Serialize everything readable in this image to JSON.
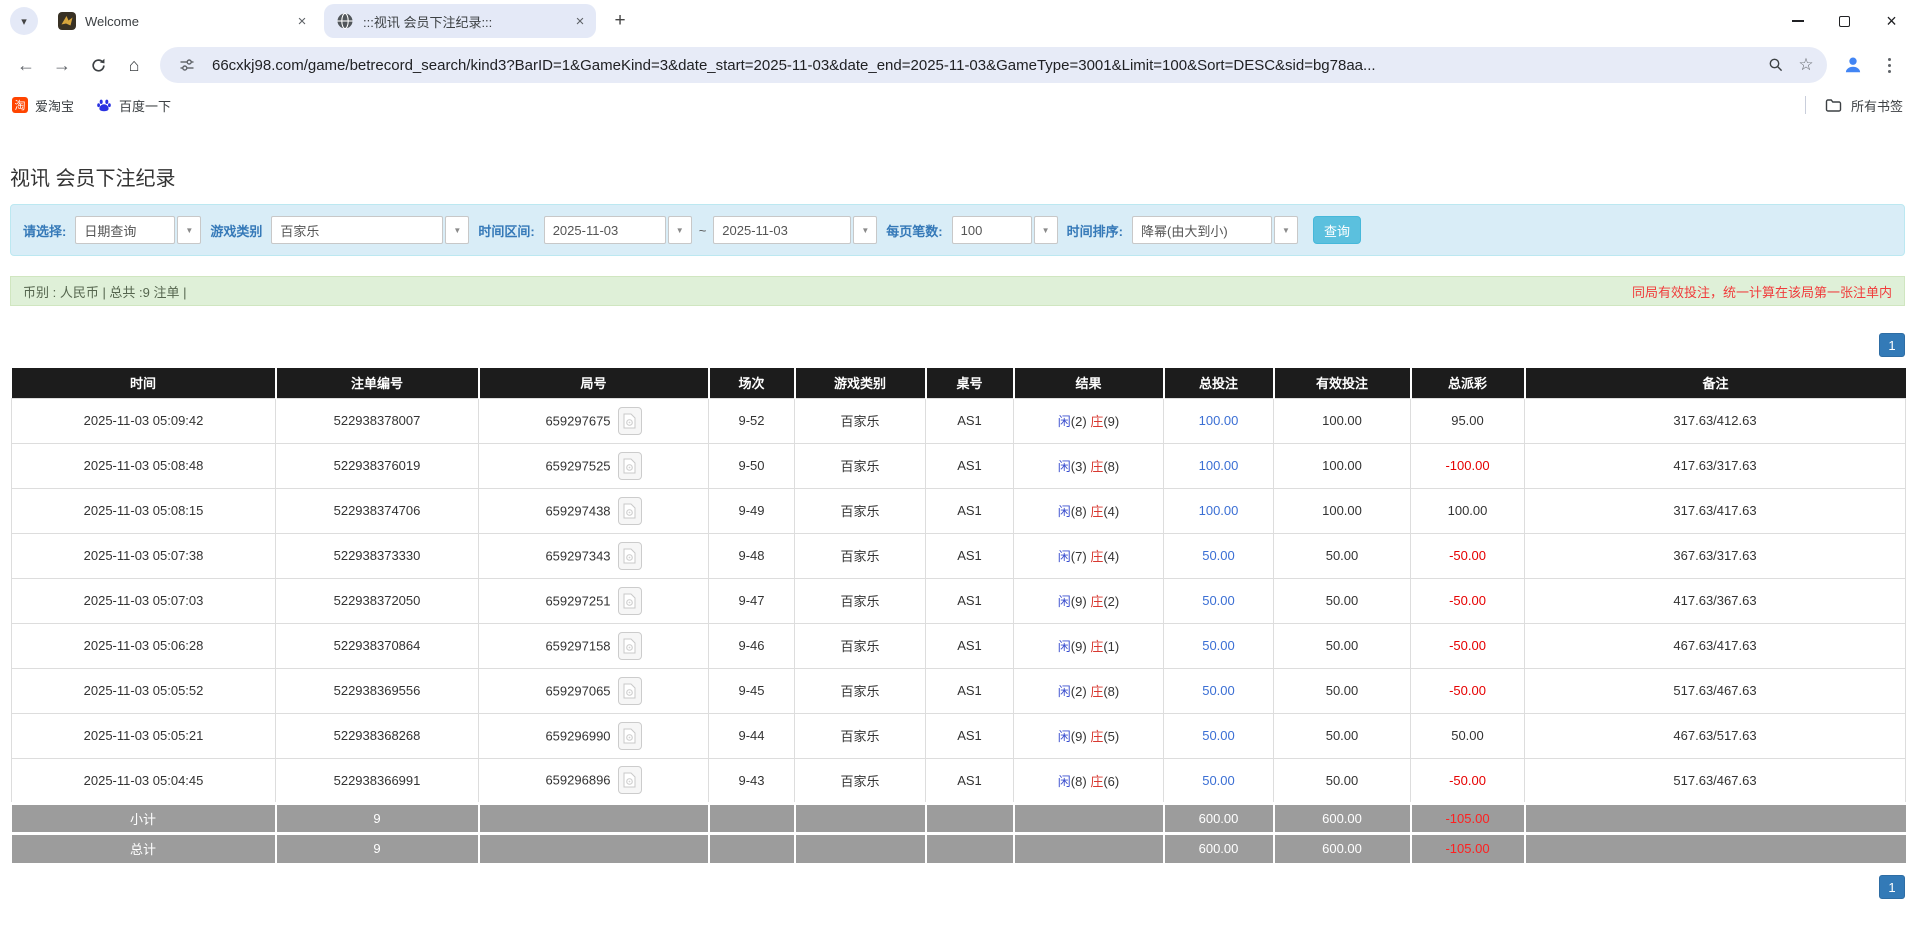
{
  "browser": {
    "tabs": [
      {
        "title": "Welcome"
      },
      {
        "title": ":::视讯 会员下注纪录:::"
      }
    ],
    "url": "66cxkj98.com/game/betrecord_search/kind3?BarID=1&GameKind=3&date_start=2025-11-03&date_end=2025-11-03&GameType=3001&Limit=100&Sort=DESC&sid=bg78aa...",
    "bookmarks": [
      {
        "label": "爱淘宝",
        "icon": "taobao-icon",
        "icon_glyph": "淘"
      },
      {
        "label": "百度一下",
        "icon": "baidu-paw-icon"
      }
    ],
    "all_bookmarks_label": "所有书签",
    "icons": {
      "chevron_down": "▾",
      "close": "×",
      "new_tab": "+",
      "back": "←",
      "forward": "→",
      "home": "⌂",
      "star": "☆"
    }
  },
  "page": {
    "title": "视讯 会员下注纪录",
    "filters": {
      "query_type_label": "请选择:",
      "query_type_value": "日期查询",
      "game_type_label": "游戏类别",
      "game_type_value": "百家乐",
      "date_range_label": "时间区间:",
      "date_start": "2025-11-03",
      "range_separator": "~",
      "date_end": "2025-11-03",
      "page_size_label": "每页笔数:",
      "page_size_value": "100",
      "sort_label": "时间排序:",
      "sort_value": "降幂(由大到小)",
      "search_button_label": "查询",
      "combo_arrow": "▼"
    },
    "summary": {
      "left_text": "币别 : 人民币 | 总共 :9 注单 |",
      "right_note": "同局有效投注，统一计算在该局第一张注单内"
    },
    "pagination": {
      "page": "1"
    },
    "colors": {
      "accent_blue": "#337ab7",
      "search_button_blue": "#5bc0de",
      "table_header_bg": "#1c1c1c",
      "table_footer_bg": "#9c9c9c",
      "negative_red": "#e60000",
      "bet_link_blue": "#3b6fd4",
      "player_blue": "#3c50d0",
      "banker_red": "#d83931",
      "filter_bar_bg": "#d9edf7",
      "summary_bar_bg": "#dff0d8"
    },
    "table": {
      "headers": [
        "时间",
        "注单编号",
        "局号",
        "场次",
        "游戏类别",
        "桌号",
        "结果",
        "总投注",
        "有效投注",
        "总派彩",
        "备注"
      ],
      "rows": [
        {
          "time": "2025-11-03 05:09:42",
          "bet_id": "522938378007",
          "round_id": "659297675",
          "session": "9-52",
          "game_type": "百家乐",
          "table_no": "AS1",
          "result": {
            "p": "闲",
            "pn": "(2)",
            "b": "庄",
            "bn": "(9)"
          },
          "total_bet": "100.00",
          "valid_bet": "100.00",
          "payout": "95.00",
          "note": "317.63/412.63"
        },
        {
          "time": "2025-11-03 05:08:48",
          "bet_id": "522938376019",
          "round_id": "659297525",
          "session": "9-50",
          "game_type": "百家乐",
          "table_no": "AS1",
          "result": {
            "p": "闲",
            "pn": "(3)",
            "b": "庄",
            "bn": "(8)"
          },
          "total_bet": "100.00",
          "valid_bet": "100.00",
          "payout": "-100.00",
          "note": "417.63/317.63"
        },
        {
          "time": "2025-11-03 05:08:15",
          "bet_id": "522938374706",
          "round_id": "659297438",
          "session": "9-49",
          "game_type": "百家乐",
          "table_no": "AS1",
          "result": {
            "p": "闲",
            "pn": "(8)",
            "b": "庄",
            "bn": "(4)"
          },
          "total_bet": "100.00",
          "valid_bet": "100.00",
          "payout": "100.00",
          "note": "317.63/417.63"
        },
        {
          "time": "2025-11-03 05:07:38",
          "bet_id": "522938373330",
          "round_id": "659297343",
          "session": "9-48",
          "game_type": "百家乐",
          "table_no": "AS1",
          "result": {
            "p": "闲",
            "pn": "(7)",
            "b": "庄",
            "bn": "(4)"
          },
          "total_bet": "50.00",
          "valid_bet": "50.00",
          "payout": "-50.00",
          "note": "367.63/317.63"
        },
        {
          "time": "2025-11-03 05:07:03",
          "bet_id": "522938372050",
          "round_id": "659297251",
          "session": "9-47",
          "game_type": "百家乐",
          "table_no": "AS1",
          "result": {
            "p": "闲",
            "pn": "(9)",
            "b": "庄",
            "bn": "(2)"
          },
          "total_bet": "50.00",
          "valid_bet": "50.00",
          "payout": "-50.00",
          "note": "417.63/367.63"
        },
        {
          "time": "2025-11-03 05:06:28",
          "bet_id": "522938370864",
          "round_id": "659297158",
          "session": "9-46",
          "game_type": "百家乐",
          "table_no": "AS1",
          "result": {
            "p": "闲",
            "pn": "(9)",
            "b": "庄",
            "bn": "(1)"
          },
          "total_bet": "50.00",
          "valid_bet": "50.00",
          "payout": "-50.00",
          "note": "467.63/417.63"
        },
        {
          "time": "2025-11-03 05:05:52",
          "bet_id": "522938369556",
          "round_id": "659297065",
          "session": "9-45",
          "game_type": "百家乐",
          "table_no": "AS1",
          "result": {
            "p": "闲",
            "pn": "(2)",
            "b": "庄",
            "bn": "(8)"
          },
          "total_bet": "50.00",
          "valid_bet": "50.00",
          "payout": "-50.00",
          "note": "517.63/467.63"
        },
        {
          "time": "2025-11-03 05:05:21",
          "bet_id": "522938368268",
          "round_id": "659296990",
          "session": "9-44",
          "game_type": "百家乐",
          "table_no": "AS1",
          "result": {
            "p": "闲",
            "pn": "(9)",
            "b": "庄",
            "bn": "(5)"
          },
          "total_bet": "50.00",
          "valid_bet": "50.00",
          "payout": "50.00",
          "note": "467.63/517.63"
        },
        {
          "time": "2025-11-03 05:04:45",
          "bet_id": "522938366991",
          "round_id": "659296896",
          "session": "9-43",
          "game_type": "百家乐",
          "table_no": "AS1",
          "result": {
            "p": "闲",
            "pn": "(8)",
            "b": "庄",
            "bn": "(6)"
          },
          "total_bet": "50.00",
          "valid_bet": "50.00",
          "payout": "-50.00",
          "note": "517.63/467.63"
        }
      ],
      "footer": [
        {
          "label": "小计",
          "count": "9",
          "total_bet": "600.00",
          "valid_bet": "600.00",
          "payout": "-105.00",
          "note": ""
        },
        {
          "label": "总计",
          "count": "9",
          "total_bet": "600.00",
          "valid_bet": "600.00",
          "payout": "-105.00",
          "note": ""
        }
      ]
    }
  }
}
